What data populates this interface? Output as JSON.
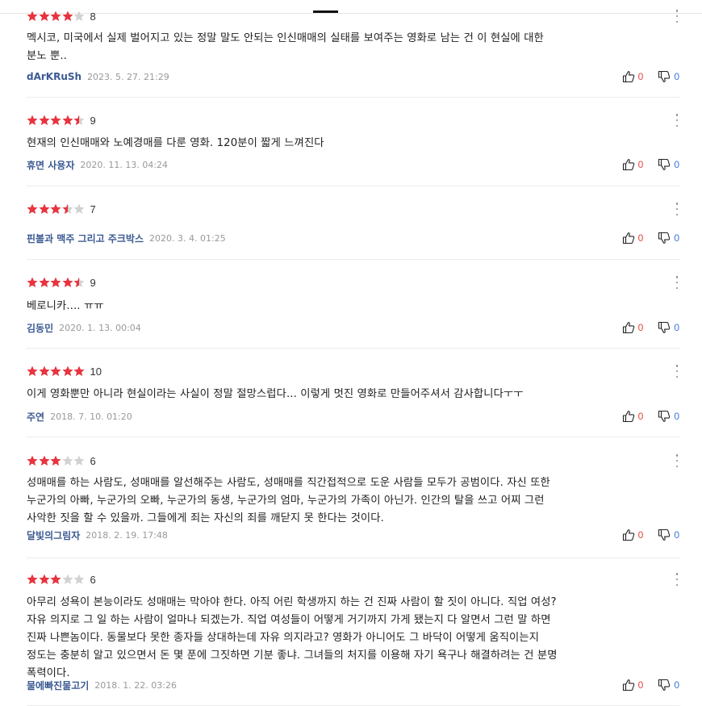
{
  "colors": {
    "star_filled": "#e8343f",
    "star_empty": "#d2d2d2",
    "author": "#3b5a92",
    "like_count": "#e4443b",
    "dislike_count": "#3b75d6"
  },
  "icons": {
    "like": "thumbs-up-icon",
    "dislike": "thumbs-down-icon",
    "more": "more-vertical-icon"
  },
  "reviews": [
    {
      "rating": 8,
      "score": "8",
      "content": "멕시코, 미국에서 실제 벌어지고 있는 정말 말도 안되는 인신매매의 실태를 보여주는 영화로 남는 건 이 현실에 대한\n분노 뿐..",
      "author": "dArKRuSh",
      "date": "2023. 5. 27. 21:29",
      "likes": "0",
      "dislikes": "0"
    },
    {
      "rating": 9,
      "score": "9",
      "content": "현재의 인신매매와 노예경매를 다룬 영화. 120분이 짧게 느껴진다",
      "author": "휴면 사용자",
      "date": "2020. 11. 13. 04:24",
      "likes": "0",
      "dislikes": "0"
    },
    {
      "rating": 7,
      "score": "7",
      "content": "",
      "author": "핀볼과 맥주 그리고 주크박스",
      "date": "2020. 3. 4. 01:25",
      "likes": "0",
      "dislikes": "0"
    },
    {
      "rating": 9,
      "score": "9",
      "content": "베로니카.... ㅠㅠ",
      "author": "김동민",
      "date": "2020. 1. 13. 00:04",
      "likes": "0",
      "dislikes": "0"
    },
    {
      "rating": 10,
      "score": "10",
      "content": "이게 영화뿐만 아니라 현실이라는 사실이 정말 절망스럽다... 이렇게 멋진 영화로 만들어주셔서 감사합니다ㅜㅜ",
      "author": "주연",
      "date": "2018. 7. 10. 01:20",
      "likes": "0",
      "dislikes": "0"
    },
    {
      "rating": 6,
      "score": "6",
      "content": "성매매를 하는 사람도, 성매매를 알선해주는 사람도, 성매매를 직간접적으로 도운 사람들 모두가 공범이다. 자신 또한\n누군가의 아빠, 누군가의 오빠, 누군가의 동생, 누군가의 엄마, 누군가의 가족이 아닌가. 인간의 탈을 쓰고 어찌 그런\n사악한 짓을 할 수 있을까. 그들에게 죄는 자신의 죄를 깨닫지 못 한다는 것이다.",
      "author": "달빛의그림자",
      "date": "2018. 2. 19. 17:48",
      "likes": "0",
      "dislikes": "0"
    },
    {
      "rating": 6,
      "score": "6",
      "content": "아무리 성욕이 본능이라도 성매매는 막아야 한다. 아직 어린 학생까지 하는 건 진짜 사람이 할 짓이 아니다. 직업 여성?\n자유 의지로 그 일 하는 사람이 얼마나 되겠는가. 직업 여성들이 어떻게 거기까지 가게 됐는지 다 알면서 그런 말 하면\n진짜 나쁜놈이다. 동물보다 못한 종자들 상대하는데 자유 의지라고? 영화가 아니어도 그 바닥이 어떻게 움직이는지\n정도는 충분히 알고 있으면서 돈 몇 푼에 그짓하면 기분 좋냐. 그녀들의 처지를 이용해 자기 욕구나 해결하려는 건 분명\n폭력이다.",
      "author": "물에빠진물고기",
      "date": "2018. 1. 22. 03:26",
      "likes": "0",
      "dislikes": "0"
    }
  ]
}
